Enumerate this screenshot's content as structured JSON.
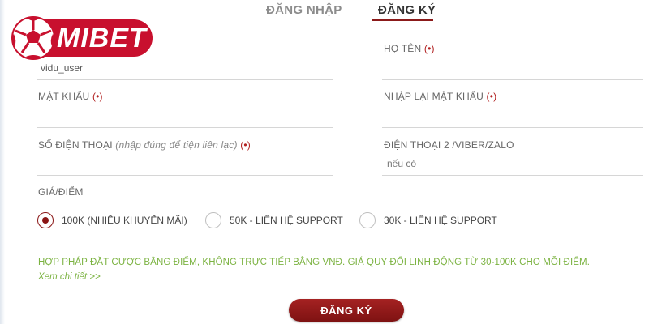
{
  "colors": {
    "brand": "#c8102e",
    "accent": "#8b1a1a",
    "notice": "#7cb342"
  },
  "logo": {
    "text": "MIBET",
    "icon": "soccer-ball-icon"
  },
  "tabs": {
    "login": "ĐĂNG NHẬP",
    "register": "ĐĂNG KÝ",
    "active": "register"
  },
  "form": {
    "username": {
      "value": "vidu_user"
    },
    "full_name": {
      "label": "HỌ TÊN",
      "required": "(•)"
    },
    "password": {
      "label": "MẬT KHẨU",
      "required": "(•)"
    },
    "confirm_password": {
      "label": "NHẬP LẠI MẬT KHẨU",
      "required": "(•)"
    },
    "phone": {
      "label": "SỐ ĐIỆN THOẠI",
      "hint": "(nhập đúng để tiện liên lạc)",
      "required": "(•)"
    },
    "phone2": {
      "label": "ĐIỆN THOẠI 2 /VIBER/ZALO",
      "placeholder": "nếu có"
    },
    "price_point": {
      "label": "GIÁ/ĐIỂM"
    }
  },
  "options": [
    {
      "label": "100K (NHIỀU KHUYẾN MÃI)",
      "checked": true
    },
    {
      "label": "50K - LIÊN HỆ SUPPORT",
      "checked": false
    },
    {
      "label": "30K - LIÊN HỆ SUPPORT",
      "checked": false
    }
  ],
  "notice": "HỢP PHÁP ĐẶT CƯỢC BẰNG ĐIỂM, KHÔNG TRỰC TIẾP BẰNG VNĐ. GIÁ QUY ĐỔI LINH ĐỘNG TỪ 30-100K CHO MỖI ĐIỂM.",
  "details_link": "Xem chi tiết >>",
  "submit_label": "ĐĂNG KÝ"
}
